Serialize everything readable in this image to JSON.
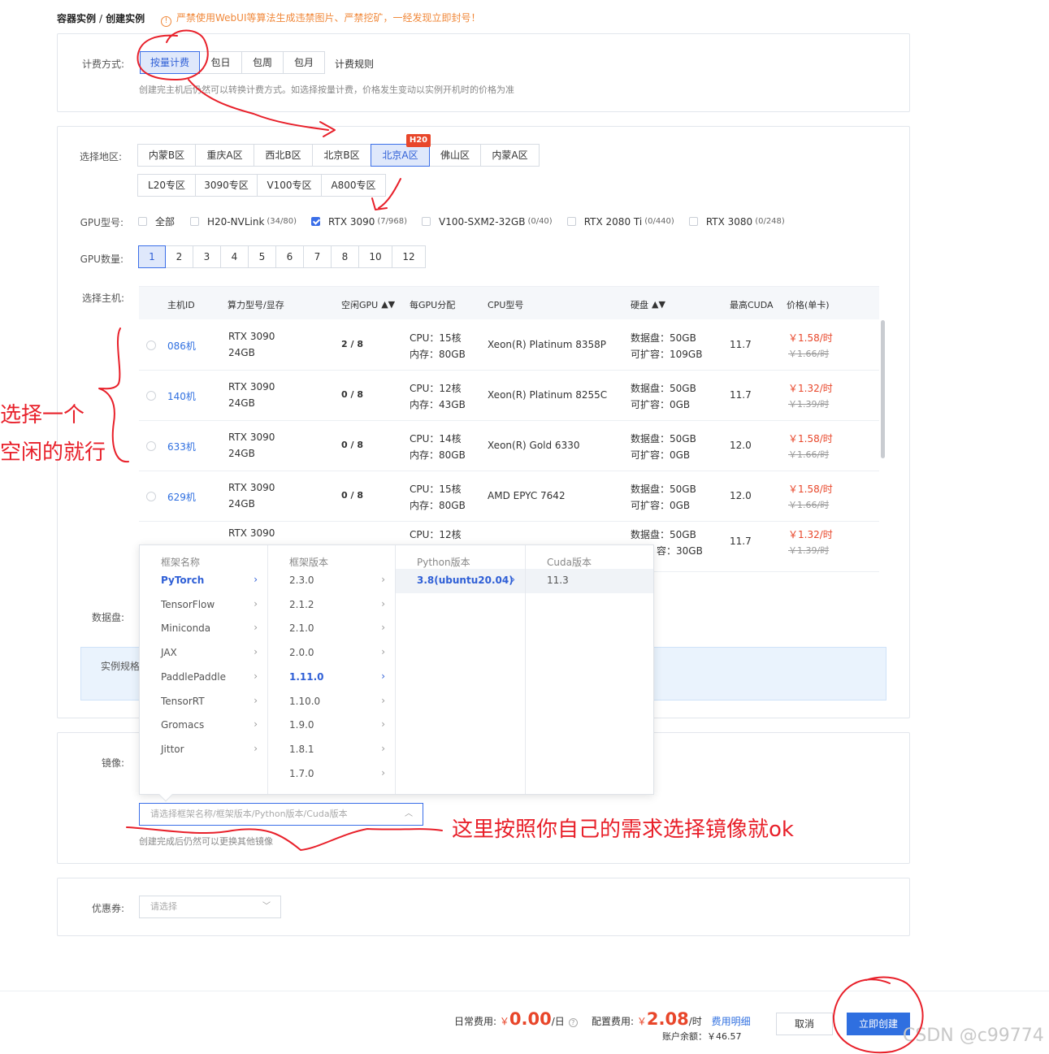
{
  "breadcrumb": {
    "parent": "容器实例",
    "separator": "/",
    "current": "创建实例"
  },
  "warning": {
    "icon": "warning-icon",
    "text": "严禁使用WebUI等算法生成违禁图片、严禁挖矿，一经发现立即封号！"
  },
  "billing": {
    "label": "计费方式:",
    "options": [
      "按量计费",
      "包日",
      "包周",
      "包月"
    ],
    "selected": "按量计费",
    "rules_link": "计费规则",
    "note": "创建完主机后仍然可以转换计费方式。如选择按量计费，价格发生变动以实例开机时的价格为准"
  },
  "region": {
    "label": "选择地区:",
    "row1": [
      "内蒙B区",
      "重庆A区",
      "西北B区",
      "北京B区",
      "北京A区",
      "佛山区",
      "内蒙A区"
    ],
    "row2": [
      "L20专区",
      "3090专区",
      "V100专区",
      "A800专区"
    ],
    "selected": "北京A区",
    "badge": "H20"
  },
  "gpu_type": {
    "label": "GPU型号:",
    "options": [
      {
        "name": "全部",
        "count": "",
        "checked": false
      },
      {
        "name": "H20-NVLink",
        "count": "(34/80)",
        "checked": false
      },
      {
        "name": "RTX 3090",
        "count": "(7/968)",
        "checked": true
      },
      {
        "name": "V100-SXM2-32GB",
        "count": "(0/40)",
        "checked": false
      },
      {
        "name": "RTX 2080 Ti",
        "count": "(0/440)",
        "checked": false
      },
      {
        "name": "RTX 3080",
        "count": "(0/248)",
        "checked": false
      }
    ]
  },
  "gpu_count": {
    "label": "GPU数量:",
    "options": [
      "1",
      "2",
      "3",
      "4",
      "5",
      "6",
      "7",
      "8",
      "10",
      "12"
    ],
    "selected": "1"
  },
  "host_table": {
    "label": "选择主机:",
    "headers": [
      "主机ID",
      "算力型号/显存",
      "空闲GPU",
      "每GPU分配",
      "CPU型号",
      "硬盘",
      "最高CUDA",
      "价格(单卡)"
    ],
    "sort_icon": "sort-icon",
    "rows": [
      {
        "id": "086机",
        "gpu": "RTX 3090",
        "mem": "24GB",
        "free": "2 / 8",
        "cpu_cores": "CPU：15核",
        "ram": "内存：80GB",
        "cpu_model": "Xeon(R) Platinum 8358P",
        "disk": "数据盘：50GB",
        "expand": "可扩容：109GB",
        "cuda": "11.7",
        "price": "￥1.58/时",
        "old_price": "￥1.66/时"
      },
      {
        "id": "140机",
        "gpu": "RTX 3090",
        "mem": "24GB",
        "free": "0 / 8",
        "cpu_cores": "CPU：12核",
        "ram": "内存：43GB",
        "cpu_model": "Xeon(R) Platinum 8255C",
        "disk": "数据盘：50GB",
        "expand": "可扩容：0GB",
        "cuda": "11.7",
        "price": "￥1.32/时",
        "old_price": "￥1.39/时"
      },
      {
        "id": "633机",
        "gpu": "RTX 3090",
        "mem": "24GB",
        "free": "0 / 8",
        "cpu_cores": "CPU：14核",
        "ram": "内存：80GB",
        "cpu_model": "Xeon(R) Gold 6330",
        "disk": "数据盘：50GB",
        "expand": "可扩容：0GB",
        "cuda": "12.0",
        "price": "￥1.58/时",
        "old_price": "￥1.66/时"
      },
      {
        "id": "629机",
        "gpu": "RTX 3090",
        "mem": "24GB",
        "free": "0 / 8",
        "cpu_cores": "CPU：15核",
        "ram": "内存：80GB",
        "cpu_model": "AMD EPYC 7642",
        "disk": "数据盘：50GB",
        "expand": "可扩容：0GB",
        "cuda": "12.0",
        "price": "￥1.58/时",
        "old_price": "￥1.66/时"
      },
      {
        "id": "",
        "gpu": "RTX 3090",
        "mem": "",
        "free": "",
        "cpu_cores": "CPU：12核",
        "ram": "",
        "cpu_model": "",
        "disk": "数据盘：50GB",
        "expand": "容：30GB",
        "cuda": "11.7",
        "price": "￥1.32/时",
        "old_price": "￥1.39/时"
      }
    ]
  },
  "data_disk": {
    "label": "数据盘:"
  },
  "spec": {
    "label": "实例规格"
  },
  "image": {
    "label": "镜像:",
    "placeholder": "请选择框架名称/框架版本/Python版本/Cuda版本",
    "note": "创建完成后仍然可以更换其他镜像",
    "dropdown": {
      "frameworks": {
        "header": "框架名称",
        "items": [
          "PyTorch",
          "TensorFlow",
          "Miniconda",
          "JAX",
          "PaddlePaddle",
          "TensorRT",
          "Gromacs",
          "Jittor"
        ],
        "selected": "PyTorch"
      },
      "versions": {
        "header": "框架版本",
        "items": [
          "2.3.0",
          "2.1.2",
          "2.1.0",
          "2.0.0",
          "1.11.0",
          "1.10.0",
          "1.9.0",
          "1.8.1",
          "1.7.0"
        ],
        "selected": "1.11.0"
      },
      "python": {
        "header": "Python版本",
        "items": [
          "3.8(ubuntu20.04)"
        ],
        "selected": "3.8(ubuntu20.04)"
      },
      "cuda": {
        "header": "Cuda版本",
        "items": [
          "11.3"
        ]
      }
    }
  },
  "coupon": {
    "label": "优惠券:",
    "placeholder": "请选择"
  },
  "footer": {
    "daily_label": "日常费用:",
    "daily_currency": "￥",
    "daily_value": "0.00",
    "daily_unit": "/日",
    "config_label": "配置费用:",
    "config_currency": "￥",
    "config_value": "2.08",
    "config_unit": "/时",
    "details_link": "费用明细",
    "balance": "账户余额：￥46.57",
    "cancel": "取消",
    "create": "立即创建"
  },
  "annotations": {
    "left_line1": "选择一个",
    "left_line2": "空闲的就行",
    "image_hint": "这里按照你自己的需求选择镜像就ok"
  },
  "watermark": "CSDN @c99774",
  "colors": {
    "accent": "#2f6fe0",
    "price": "#e8462a",
    "annotation": "#e8202a",
    "warning": "#f0883a"
  }
}
